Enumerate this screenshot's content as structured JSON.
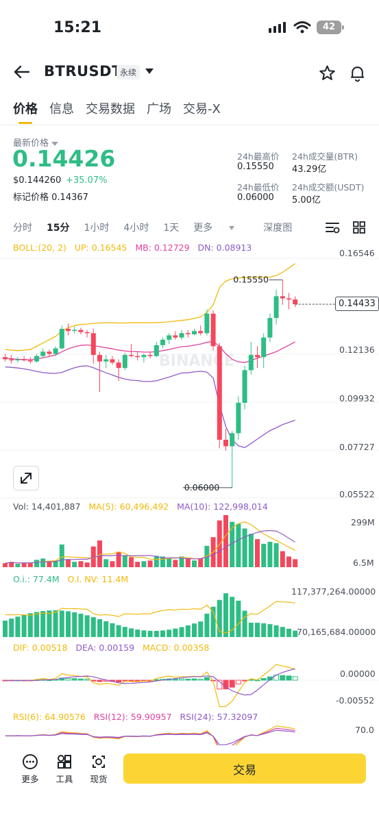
{
  "status_bar": {
    "time": "15:21",
    "battery": "42"
  },
  "header": {
    "symbol": "BTRUSDT",
    "contract_type": "永续"
  },
  "tabs": [
    {
      "label": "价格"
    },
    {
      "label": "信息"
    },
    {
      "label": "交易数据"
    },
    {
      "label": "广场"
    },
    {
      "label": "交易-X"
    }
  ],
  "price": {
    "label": "最新价格",
    "last": "0.14426",
    "usd": "$0.144260",
    "change": "+35.07%",
    "mark_label": "标记价格",
    "mark_value": "0.14367"
  },
  "stats": {
    "high_label": "24h最高价",
    "high_value": "0.15550",
    "vol_btr_label": "24h成交量(BTR)",
    "vol_btr_value": "43.29亿",
    "low_label": "24h最低价",
    "low_value": "0.06000",
    "vol_usdt_label": "24h成交额(USDT)",
    "vol_usdt_value": "5.00亿"
  },
  "intervals": [
    "分时",
    "15分",
    "1小时",
    "4小时",
    "1天",
    "更多",
    "深度图"
  ],
  "active_interval": "15分",
  "boll": {
    "label": "BOLL:(20, 2)",
    "up": "UP: 0.16545",
    "mb": "MB: 0.12729",
    "dn": "DN: 0.08913"
  },
  "price_axis": [
    "0.16546",
    "0.12136",
    "0.09932",
    "0.07727",
    "0.05522"
  ],
  "annotations": {
    "high": "0.15550",
    "low": "0.06000",
    "current": "0.14433"
  },
  "watermark": "BINANCE",
  "volume": {
    "vol": "Vol: 14,401,887",
    "ma5": "MA(5): 60,496,492",
    "ma10": "MA(10): 122,998,014",
    "axis_top": "299M",
    "axis_bottom": "6.5M"
  },
  "oi": {
    "oi": "O.i.: 77.4M",
    "nv": "O.I. NV: 11.4M",
    "axis_top": "117,377,264.00000",
    "axis_bottom": "70,165,684.00000"
  },
  "macd": {
    "dif": "DIF: 0.00518",
    "dea": "DEA: 0.00159",
    "macd": "MACD: 0.00358",
    "axis_top": "0.00000",
    "axis_bottom": "-0.00552"
  },
  "rsi": {
    "rsi6": "RSI(6): 64.90576",
    "rsi12": "RSI(12): 59.90957",
    "rsi24": "RSI(24): 57.32097",
    "axis_top": "70.0"
  },
  "bottom_nav": {
    "more": "更多",
    "tools": "工具",
    "spot": "现货",
    "trade": "交易"
  },
  "colors": {
    "up": "#2ebd85",
    "down": "#f6465d",
    "accent": "#fcd535",
    "boll_up": "#f0b90b",
    "boll_mb": "#e040a0",
    "boll_dn": "#8e5ac8"
  },
  "chart_data": {
    "type": "candlestick",
    "interval": "15分",
    "ylim": [
      0.05522,
      0.16546
    ],
    "candles": [
      {
        "o": 0.12,
        "h": 0.1215,
        "l": 0.118,
        "c": 0.119
      },
      {
        "o": 0.119,
        "h": 0.121,
        "l": 0.117,
        "c": 0.1185
      },
      {
        "o": 0.1185,
        "h": 0.12,
        "l": 0.1175,
        "c": 0.119
      },
      {
        "o": 0.119,
        "h": 0.1205,
        "l": 0.118,
        "c": 0.1185
      },
      {
        "o": 0.1185,
        "h": 0.12,
        "l": 0.117,
        "c": 0.118
      },
      {
        "o": 0.118,
        "h": 0.1215,
        "l": 0.1175,
        "c": 0.1205
      },
      {
        "o": 0.1205,
        "h": 0.124,
        "l": 0.1195,
        "c": 0.1225
      },
      {
        "o": 0.1225,
        "h": 0.1235,
        "l": 0.12,
        "c": 0.1215
      },
      {
        "o": 0.1215,
        "h": 0.125,
        "l": 0.1205,
        "c": 0.124
      },
      {
        "o": 0.124,
        "h": 0.1345,
        "l": 0.1235,
        "c": 0.133
      },
      {
        "o": 0.133,
        "h": 0.1355,
        "l": 0.13,
        "c": 0.132
      },
      {
        "o": 0.132,
        "h": 0.134,
        "l": 0.131,
        "c": 0.1325
      },
      {
        "o": 0.1325,
        "h": 0.1335,
        "l": 0.1305,
        "c": 0.1315
      },
      {
        "o": 0.1315,
        "h": 0.1325,
        "l": 0.129,
        "c": 0.131
      },
      {
        "o": 0.131,
        "h": 0.133,
        "l": 0.117,
        "c": 0.121
      },
      {
        "o": 0.121,
        "h": 0.1225,
        "l": 0.104,
        "c": 0.118
      },
      {
        "o": 0.118,
        "h": 0.121,
        "l": 0.115,
        "c": 0.119
      },
      {
        "o": 0.119,
        "h": 0.1205,
        "l": 0.1165,
        "c": 0.1175
      },
      {
        "o": 0.1175,
        "h": 0.119,
        "l": 0.109,
        "c": 0.115
      },
      {
        "o": 0.115,
        "h": 0.122,
        "l": 0.114,
        "c": 0.121
      },
      {
        "o": 0.121,
        "h": 0.126,
        "l": 0.12,
        "c": 0.1205
      },
      {
        "o": 0.1205,
        "h": 0.1225,
        "l": 0.1185,
        "c": 0.12
      },
      {
        "o": 0.12,
        "h": 0.1215,
        "l": 0.1175,
        "c": 0.121
      },
      {
        "o": 0.121,
        "h": 0.1225,
        "l": 0.1195,
        "c": 0.1205
      },
      {
        "o": 0.1205,
        "h": 0.127,
        "l": 0.12,
        "c": 0.1255
      },
      {
        "o": 0.1255,
        "h": 0.129,
        "l": 0.124,
        "c": 0.128
      },
      {
        "o": 0.128,
        "h": 0.131,
        "l": 0.126,
        "c": 0.13
      },
      {
        "o": 0.13,
        "h": 0.132,
        "l": 0.128,
        "c": 0.129
      },
      {
        "o": 0.129,
        "h": 0.1325,
        "l": 0.128,
        "c": 0.131
      },
      {
        "o": 0.131,
        "h": 0.1325,
        "l": 0.129,
        "c": 0.1305
      },
      {
        "o": 0.1305,
        "h": 0.133,
        "l": 0.13,
        "c": 0.132
      },
      {
        "o": 0.132,
        "h": 0.1345,
        "l": 0.13,
        "c": 0.131
      },
      {
        "o": 0.131,
        "h": 0.142,
        "l": 0.13,
        "c": 0.14
      },
      {
        "o": 0.14,
        "h": 0.1415,
        "l": 0.123,
        "c": 0.125
      },
      {
        "o": 0.125,
        "h": 0.1265,
        "l": 0.078,
        "c": 0.082
      },
      {
        "o": 0.082,
        "h": 0.087,
        "l": 0.077,
        "c": 0.079
      },
      {
        "o": 0.079,
        "h": 0.086,
        "l": 0.06,
        "c": 0.085
      },
      {
        "o": 0.085,
        "h": 0.102,
        "l": 0.082,
        "c": 0.099
      },
      {
        "o": 0.099,
        "h": 0.116,
        "l": 0.096,
        "c": 0.114
      },
      {
        "o": 0.114,
        "h": 0.127,
        "l": 0.112,
        "c": 0.121
      },
      {
        "o": 0.121,
        "h": 0.125,
        "l": 0.115,
        "c": 0.12
      },
      {
        "o": 0.12,
        "h": 0.131,
        "l": 0.115,
        "c": 0.129
      },
      {
        "o": 0.129,
        "h": 0.14,
        "l": 0.127,
        "c": 0.138
      },
      {
        "o": 0.138,
        "h": 0.151,
        "l": 0.135,
        "c": 0.148
      },
      {
        "o": 0.148,
        "h": 0.1555,
        "l": 0.144,
        "c": 0.147
      },
      {
        "o": 0.147,
        "h": 0.1495,
        "l": 0.142,
        "c": 0.1465
      },
      {
        "o": 0.1465,
        "h": 0.148,
        "l": 0.143,
        "c": 0.1443
      }
    ],
    "boll_up": [
      0.1235,
      0.1232,
      0.123,
      0.1232,
      0.1235,
      0.125,
      0.1265,
      0.128,
      0.1295,
      0.132,
      0.1335,
      0.1345,
      0.135,
      0.1352,
      0.1355,
      0.1357,
      0.1358,
      0.1358,
      0.1357,
      0.1357,
      0.1358,
      0.1358,
      0.1358,
      0.1358,
      0.1359,
      0.136,
      0.1362,
      0.1366,
      0.1369,
      0.1372,
      0.1378,
      0.1385,
      0.1405,
      0.144,
      0.152,
      0.155,
      0.156,
      0.1564,
      0.1566,
      0.1567,
      0.1567,
      0.1567,
      0.1568,
      0.1575,
      0.159,
      0.161,
      0.163
    ],
    "boll_mb": [
      0.1195,
      0.1193,
      0.119,
      0.1189,
      0.1188,
      0.1192,
      0.1197,
      0.1203,
      0.121,
      0.1225,
      0.1238,
      0.1248,
      0.1254,
      0.1256,
      0.1253,
      0.1248,
      0.1243,
      0.1238,
      0.1232,
      0.1228,
      0.1226,
      0.1225,
      0.1223,
      0.1223,
      0.1225,
      0.123,
      0.1235,
      0.1242,
      0.1248,
      0.125,
      0.1255,
      0.126,
      0.1268,
      0.1272,
      0.125,
      0.1215,
      0.119,
      0.1178,
      0.1175,
      0.1185,
      0.1195,
      0.1205,
      0.1215,
      0.1225,
      0.124,
      0.1255,
      0.127
    ],
    "boll_dn": [
      0.1155,
      0.1153,
      0.115,
      0.1146,
      0.1141,
      0.1134,
      0.1129,
      0.1126,
      0.1125,
      0.113,
      0.1141,
      0.1151,
      0.1158,
      0.116,
      0.1151,
      0.1139,
      0.1128,
      0.1118,
      0.1107,
      0.1099,
      0.1094,
      0.1092,
      0.1088,
      0.1088,
      0.1091,
      0.11,
      0.1108,
      0.1118,
      0.1127,
      0.1128,
      0.1132,
      0.1135,
      0.1131,
      0.1104,
      0.098,
      0.088,
      0.082,
      0.0792,
      0.0784,
      0.0803,
      0.0823,
      0.0843,
      0.0862,
      0.0875,
      0.089,
      0.09,
      0.091
    ],
    "volume": [
      0.6,
      0.8,
      0.5,
      0.7,
      0.6,
      1.1,
      1.3,
      0.9,
      1.0,
      3.4,
      1.2,
      0.8,
      0.9,
      0.7,
      3.1,
      4.0,
      1.2,
      0.9,
      2.3,
      1.8,
      1.5,
      0.8,
      0.9,
      1.0,
      1.7,
      1.6,
      1.4,
      1.1,
      1.6,
      1.3,
      1.0,
      1.3,
      3.2,
      4.5,
      7.0,
      7.8,
      6.8,
      6.5,
      5.8,
      5.0,
      4.2,
      3.5,
      3.8,
      3.6,
      2.4,
      1.6,
      1.2
    ]
  }
}
